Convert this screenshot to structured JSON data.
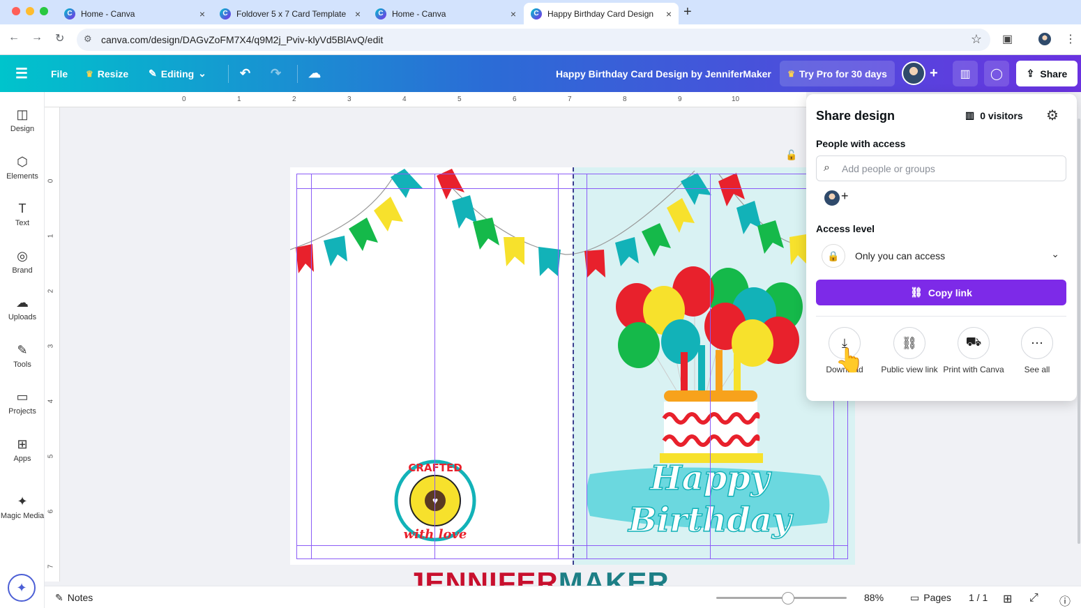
{
  "browser": {
    "tabs": [
      {
        "title": "Home - Canva",
        "active": false
      },
      {
        "title": "Foldover 5 x 7 Card Template",
        "active": false
      },
      {
        "title": "Home - Canva",
        "active": false
      },
      {
        "title": "Happy Birthday Card Design",
        "active": true
      }
    ],
    "url": "canva.com/design/DAGvZoFM7X4/q9M2j_Pviv-klyVd5BlAvQ/edit"
  },
  "toolbar": {
    "file_label": "File",
    "resize_label": "Resize",
    "editing_label": "Editing",
    "design_title": "Happy Birthday Card Design by JenniferMaker",
    "try_pro_label": "Try Pro for 30 days",
    "share_label": "Share"
  },
  "sidebar": {
    "items": [
      {
        "label": "Design",
        "icon": "design-icon"
      },
      {
        "label": "Elements",
        "icon": "elements-icon"
      },
      {
        "label": "Text",
        "icon": "text-icon"
      },
      {
        "label": "Brand",
        "icon": "brand-icon"
      },
      {
        "label": "Uploads",
        "icon": "uploads-icon"
      },
      {
        "label": "Tools",
        "icon": "tools-icon"
      },
      {
        "label": "Projects",
        "icon": "projects-icon"
      },
      {
        "label": "Apps",
        "icon": "apps-icon"
      },
      {
        "label": "Magic Media",
        "icon": "magic-media-icon"
      }
    ]
  },
  "ruler": {
    "h": [
      "0",
      "1",
      "2",
      "3",
      "4",
      "5",
      "6",
      "7",
      "8",
      "9",
      "10"
    ],
    "v": [
      "0",
      "1",
      "2",
      "3",
      "4",
      "5",
      "6",
      "7"
    ]
  },
  "share_panel": {
    "title": "Share design",
    "visitors": "0 visitors",
    "people_label": "People with access",
    "search_placeholder": "Add people or groups",
    "access_label": "Access level",
    "access_value": "Only you can access",
    "copy_link_label": "Copy link",
    "actions": [
      {
        "label": "Download",
        "icon": "download-icon"
      },
      {
        "label": "Public view link",
        "icon": "link-icon"
      },
      {
        "label": "Print with Canva",
        "icon": "truck-icon"
      },
      {
        "label": "See all",
        "icon": "more-icon"
      }
    ]
  },
  "design": {
    "badge_top": "CRAFTED",
    "badge_bottom": "with love",
    "greeting_line1": "Happy",
    "greeting_line2": "Birthday"
  },
  "watermark": {
    "part1": "JENNIFER",
    "part2": "MAKER"
  },
  "bottom": {
    "notes_label": "Notes",
    "zoom": "88%",
    "pages_label": "Pages",
    "page_count": "1 / 1"
  },
  "colors": {
    "purple": "#7d2ae8",
    "teal": "#00c4cc",
    "banner_red": "#e8212c",
    "banner_yellow": "#f7e12c",
    "banner_green": "#15b94a",
    "banner_teal": "#12b2b8"
  }
}
